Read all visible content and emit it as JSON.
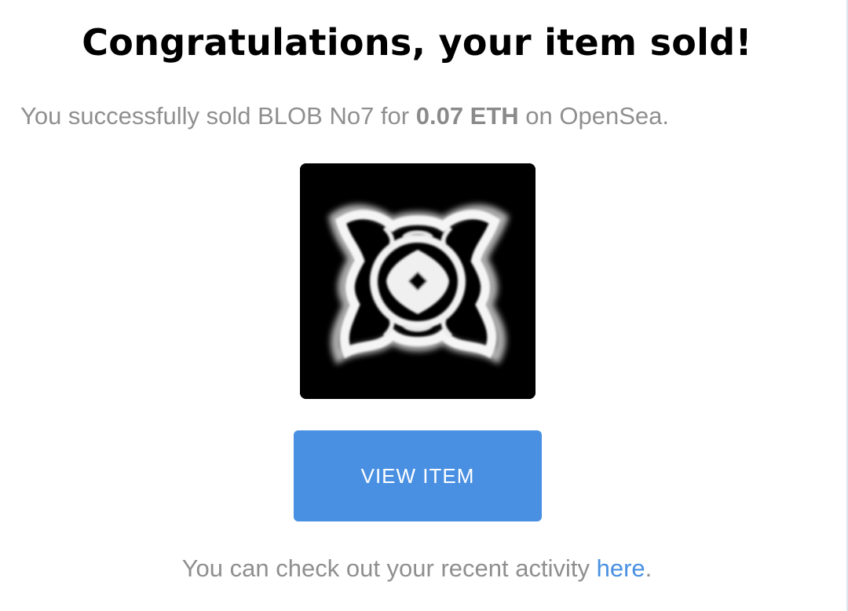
{
  "email": {
    "title": "Congratulations, your item sold!",
    "summary": {
      "prefix": "You successfully sold BLOB No7 for ",
      "price": "0.07 ETH",
      "suffix": " on OpenSea."
    },
    "item_image": {
      "icon": "blob-artwork",
      "background": "#000000"
    },
    "button": {
      "label": "VIEW ITEM",
      "color": "#4a90e2"
    },
    "footer": {
      "text": "You can check out your recent activity ",
      "link_label": "here",
      "trailing": "."
    }
  }
}
